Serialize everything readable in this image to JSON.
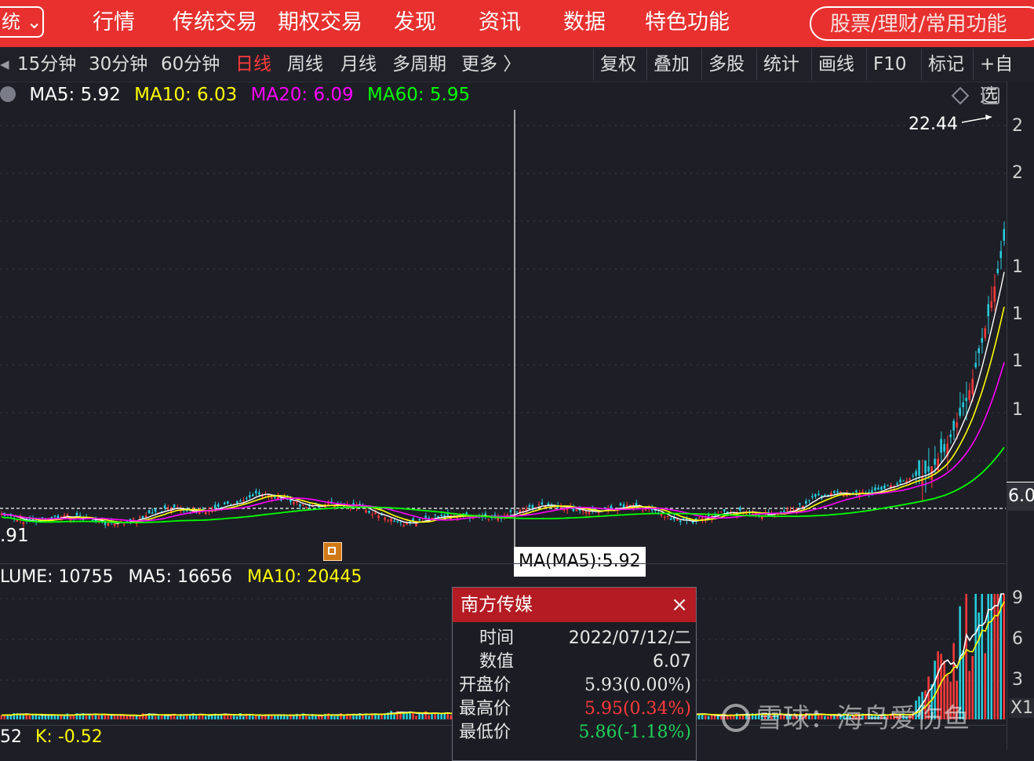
{
  "topbar": {
    "system_label": "统",
    "nav": [
      "行情",
      "传统交易",
      "期权交易",
      "发现",
      "资讯",
      "数据",
      "特色功能"
    ],
    "search_placeholder": "股票/理财/常用功能"
  },
  "toolbar": {
    "periods": [
      "15分钟",
      "30分钟",
      "60分钟",
      "日线",
      "周线",
      "月线",
      "多周期",
      "更多 〉"
    ],
    "active_period": "日线",
    "tools": [
      "复权",
      "叠加",
      "多股",
      "统计",
      "画线",
      "F10",
      "标记",
      "+自选"
    ]
  },
  "ma_legend": [
    {
      "text": "MA5: 5.92",
      "color": "#ffffff"
    },
    {
      "text": "MA10: 6.03",
      "color": "#ffff00"
    },
    {
      "text": "MA20: 6.09",
      "color": "#ff00ff"
    },
    {
      "text": "MA60: 5.95",
      "color": "#00ff00"
    }
  ],
  "labels": {
    "peak": "22.44",
    "low": ".91",
    "crosshair_tip": "MA(MA5):5.92",
    "price_tag": "6.0"
  },
  "volume_legend": [
    {
      "text": "LUME: 10755",
      "color": "#ffffff"
    },
    {
      "text": "MA5: 16656",
      "color": "#ffffff"
    },
    {
      "text": "MA10: 20445",
      "color": "#ffff00"
    }
  ],
  "kdj_legend": [
    {
      "text": "52",
      "color": "#ffffff"
    },
    {
      "text": "K: -0.52",
      "color": "#ffff00"
    }
  ],
  "right_axis": {
    "main": [
      "2",
      "2",
      "1",
      "1",
      "1",
      "1"
    ],
    "volume": [
      "9",
      "6",
      "3"
    ],
    "volume_scale": "X1"
  },
  "popup": {
    "title": "南方传媒",
    "close": "×",
    "rows": [
      {
        "label": "时间",
        "value": "2022/07/12/二",
        "color": "#e6e6e6"
      },
      {
        "label": "数值",
        "value": "6.07",
        "color": "#e6e6e6"
      },
      {
        "label": "开盘价",
        "value": "5.93(0.00%)",
        "color": "#e6e6e6"
      },
      {
        "label": "最高价",
        "value": "5.95(0.34%)",
        "color": "#ff3b3b"
      },
      {
        "label": "最低价",
        "value": "5.86(-1.18%)",
        "color": "#1fd15b"
      }
    ]
  },
  "watermark": "雪球：海鸟爱伤鱼",
  "colors": {
    "up": "#ff3b3b",
    "down": "#26d0e0",
    "ma5": "#ffffff",
    "ma10": "#ffff00",
    "ma20": "#ff00ff",
    "ma60": "#00ff00",
    "topbar": "#e8312f"
  }
}
